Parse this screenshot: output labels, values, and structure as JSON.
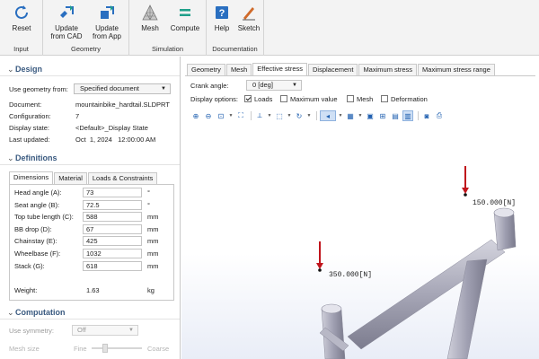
{
  "ribbon": {
    "groups": [
      {
        "name": "Input",
        "buttons": [
          {
            "label": "Reset"
          }
        ]
      },
      {
        "name": "Geometry",
        "buttons": [
          {
            "label": "Update\nfrom CAD"
          },
          {
            "label": "Update\nfrom App"
          }
        ]
      },
      {
        "name": "Simulation",
        "buttons": [
          {
            "label": "Mesh"
          },
          {
            "label": "Compute"
          }
        ]
      },
      {
        "name": "Documentation",
        "buttons": [
          {
            "label": "Help"
          },
          {
            "label": "Sketch"
          }
        ]
      }
    ]
  },
  "design": {
    "title": "Design",
    "use_geometry_label": "Use geometry from:",
    "use_geometry_value": "Specified document",
    "document_label": "Document:",
    "document_value": "mountainbike_hardtail.SLDPRT",
    "configuration_label": "Configuration:",
    "configuration_value": "7",
    "display_state_label": "Display state:",
    "display_state_value": "<Default>_Display State",
    "last_updated_label": "Last updated:",
    "last_updated_value": "Oct  1, 2024   12:00:00 AM"
  },
  "definitions": {
    "title": "Definitions",
    "tabs": [
      "Dimensions",
      "Material",
      "Loads & Constraints"
    ],
    "params": [
      {
        "label": "Head angle (A):",
        "value": "73",
        "unit": "°"
      },
      {
        "label": "Seat angle (B):",
        "value": "72.5",
        "unit": "°"
      },
      {
        "label": "Top tube length (C):",
        "value": "588",
        "unit": "mm"
      },
      {
        "label": "BB drop (D):",
        "value": "67",
        "unit": "mm"
      },
      {
        "label": "Chainstay (E):",
        "value": "425",
        "unit": "mm"
      },
      {
        "label": "Wheelbase (F):",
        "value": "1032",
        "unit": "mm"
      },
      {
        "label": "Stack (G):",
        "value": "618",
        "unit": "mm"
      }
    ],
    "weight_label": "Weight:",
    "weight_value": "1.63",
    "weight_unit": "kg"
  },
  "computation": {
    "title": "Computation",
    "symmetry_label": "Use symmetry:",
    "symmetry_value": "Off",
    "mesh_size_label": "Mesh size",
    "mesh_coarse": "Coarse",
    "mesh_fine": "Fine"
  },
  "main": {
    "tabs": [
      "Geometry",
      "Mesh",
      "Effective stress",
      "Displacement",
      "Maximum stress",
      "Maximum stress range"
    ],
    "active_tab": "Effective stress",
    "crank_angle_label": "Crank angle:",
    "crank_angle_value": "0 [deg]",
    "display_options_label": "Display options:",
    "options": [
      {
        "label": "Loads",
        "checked": true
      },
      {
        "label": "Maximum value",
        "checked": false
      },
      {
        "label": "Mesh",
        "checked": false
      },
      {
        "label": "Deformation",
        "checked": false
      }
    ],
    "load_1": "150.000[N]",
    "load_2": "350.000[N]"
  },
  "colors": {
    "accent": "#2a6fc0",
    "load_arrow": "#c0141c",
    "section_title": "#3a5a80",
    "frame": "#a9a9b8"
  }
}
